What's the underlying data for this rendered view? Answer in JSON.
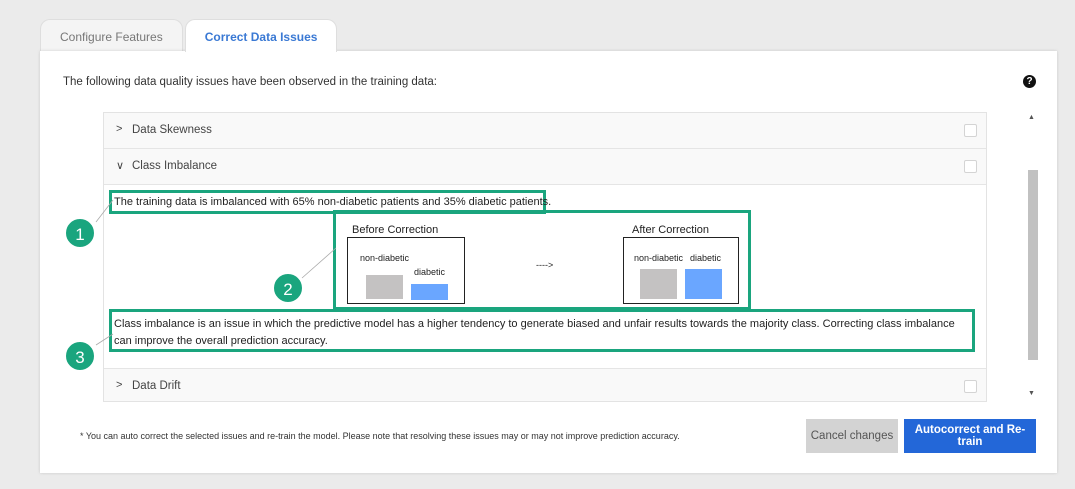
{
  "tabs": [
    {
      "label": "Configure Features",
      "active": false
    },
    {
      "label": "Correct Data Issues",
      "active": true
    }
  ],
  "intro_text": "The following data quality issues have been observed in the training data:",
  "help_icon": "?",
  "issues": [
    {
      "label": "Data Skewness",
      "expanded": false,
      "checked": false
    },
    {
      "label": "Class Imbalance",
      "expanded": true,
      "checked": false
    },
    {
      "label": "Data Drift",
      "expanded": false,
      "checked": false
    }
  ],
  "chevrons": {
    "collapsed": ">",
    "expanded": "∨"
  },
  "details": {
    "summary": "The training data is imbalanced with 65% non-diabetic patients and 35% diabetic patients.",
    "before": {
      "title": "Before Correction",
      "label_a": "non-diabetic",
      "label_b": "diabetic"
    },
    "arrow": "---->",
    "after": {
      "title": "After Correction",
      "label_a": "non-diabetic",
      "label_b": "diabetic"
    },
    "explanation": "Class imbalance is an issue in which the predictive model has a higher tendency to generate biased and unfair results towards the majority class. Correcting class imbalance can improve the overall prediction accuracy."
  },
  "badges": [
    "1",
    "2",
    "3"
  ],
  "footnote": "* You can auto correct the selected issues and re-train the model. Please note that resolving these issues may or may not improve prediction accuracy.",
  "buttons": {
    "cancel": "Cancel changes",
    "primary": "Autocorrect and Re-train"
  },
  "colors": {
    "accent": "#1aa57e",
    "primary": "#2367d8",
    "bar_gray": "#c4c2c2",
    "bar_blue": "#6aa6ff"
  }
}
